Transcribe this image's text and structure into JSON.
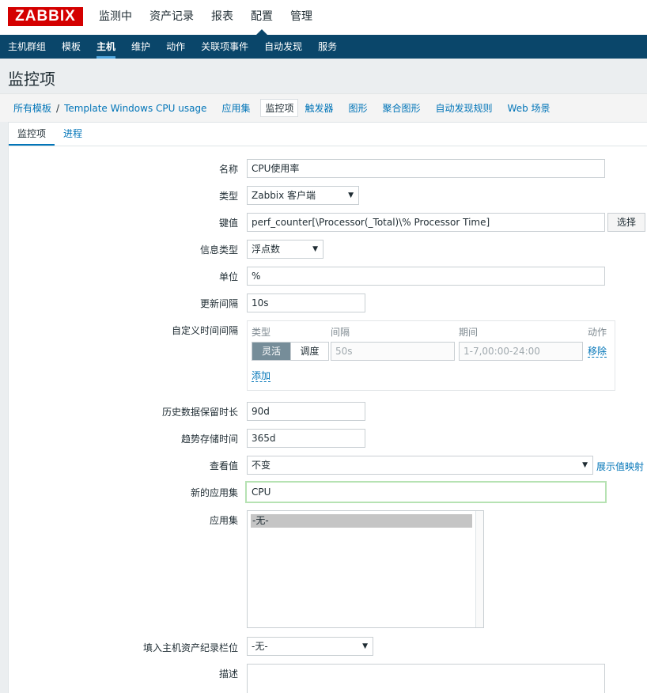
{
  "logo": "ZABBIX",
  "topnav": [
    "监测中",
    "资产记录",
    "报表",
    "配置",
    "管理"
  ],
  "subnav": [
    "主机群组",
    "模板",
    "主机",
    "维护",
    "动作",
    "关联项事件",
    "自动发现",
    "服务"
  ],
  "page_title": "监控项",
  "breadcrumb": {
    "all_templates": "所有模板",
    "separator": "/",
    "template": "Template Windows CPU usage",
    "tabs": [
      "应用集",
      "监控项",
      "触发器",
      "图形",
      "聚合图形",
      "自动发现规则",
      "Web 场景"
    ]
  },
  "form_tabs": [
    "监控项",
    "进程"
  ],
  "form": {
    "name_label": "名称",
    "name_value": "CPU使用率",
    "type_label": "类型",
    "type_value": "Zabbix 客户端",
    "key_label": "键值",
    "key_value": "perf_counter[\\Processor(_Total)\\% Processor Time]",
    "select_button": "选择",
    "info_type_label": "信息类型",
    "info_type_value": "浮点数",
    "units_label": "单位",
    "units_value": "%",
    "interval_label": "更新间隔",
    "interval_value": "10s",
    "custom_intervals_label": "自定义时间间隔",
    "custom_intervals": {
      "col_type": "类型",
      "col_interval": "间隔",
      "col_period": "期间",
      "col_action": "动作",
      "flexible": "灵活",
      "scheduling": "调度",
      "interval_placeholder": "50s",
      "period_placeholder": "1-7,00:00-24:00",
      "remove": "移除",
      "add": "添加"
    },
    "history_label": "历史数据保留时长",
    "history_value": "90d",
    "trends_label": "趋势存储时间",
    "trends_value": "365d",
    "show_value_label": "查看值",
    "show_value_value": "不变",
    "show_value_mapping_link": "展示值映射",
    "new_application_label": "新的应用集",
    "new_application_value": "CPU",
    "applications_label": "应用集",
    "applications_option": "-无-",
    "inventory_label": "填入主机资产纪录栏位",
    "inventory_value": "-无-",
    "description_label": "描述"
  },
  "colors": {
    "brand_red": "#d40000",
    "nav_blue": "#0a466a",
    "link_blue": "#0275b8",
    "focus_green": "#b6e2b3"
  }
}
